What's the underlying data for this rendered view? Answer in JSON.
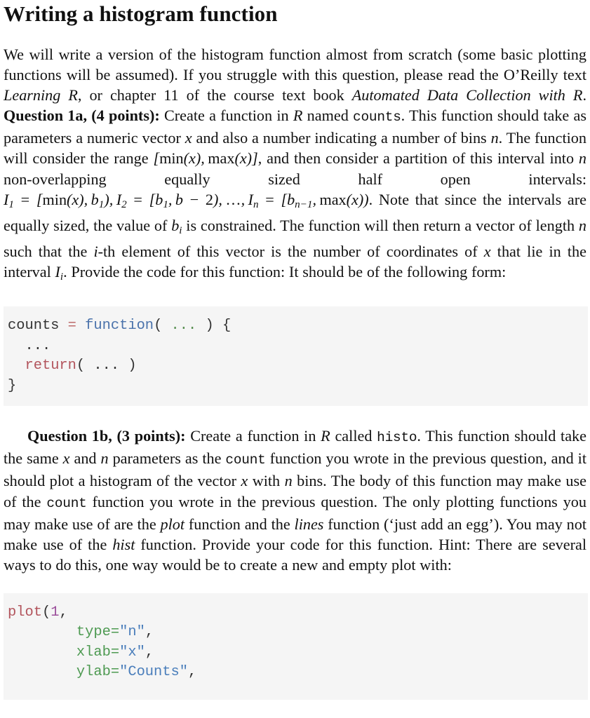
{
  "document": {
    "title": "Writing a histogram function",
    "paragraph_1": {
      "segments": [
        {
          "text": "We will write a version of the histogram function almost from scratch (some basic plotting functions will be assumed). If you struggle with this question, please read the O’Reilly text ",
          "style": "normal"
        },
        {
          "text": "Learning R",
          "style": "italic"
        },
        {
          "text": ", or chapter 11 of the course text book ",
          "style": "normal"
        },
        {
          "text": "Automated Data Collection with R",
          "style": "italic"
        },
        {
          "text": ". ",
          "style": "normal"
        },
        {
          "text": "Question 1a, (4 points):",
          "style": "bold"
        },
        {
          "text": " Create a function in ",
          "style": "normal"
        },
        {
          "text": "R",
          "style": "math-italic"
        },
        {
          "text": " named ",
          "style": "normal"
        },
        {
          "text": "counts",
          "style": "mono"
        },
        {
          "text": ". This function should take as parameters a numeric vector ",
          "style": "normal"
        },
        {
          "text": "x",
          "style": "math-italic"
        },
        {
          "text": " and also a number indicating a number of bins ",
          "style": "normal"
        },
        {
          "text": "n",
          "style": "math-italic"
        },
        {
          "text": ". The function will consider the range ",
          "style": "normal"
        },
        {
          "text": "[min(x), max(x)]",
          "style": "math"
        },
        {
          "text": ", and then consider a partition of this interval into ",
          "style": "normal"
        },
        {
          "text": "n",
          "style": "math-italic"
        },
        {
          "text": " non-overlapping equally sized half open intervals: ",
          "style": "normal"
        },
        {
          "text": "I1 = [min(x), b1), I2 = [b1, b − 2), … , In = [bn−1, max(x))",
          "style": "math"
        },
        {
          "text": ". Note that since the intervals are equally sized, the value of ",
          "style": "normal"
        },
        {
          "text": "bi",
          "style": "math"
        },
        {
          "text": " is constrained. The function will then return a vector of length ",
          "style": "normal"
        },
        {
          "text": "n",
          "style": "math-italic"
        },
        {
          "text": " such that the ",
          "style": "normal"
        },
        {
          "text": "i",
          "style": "math-italic"
        },
        {
          "text": "-th element of this vector is the number of coordinates of ",
          "style": "normal"
        },
        {
          "text": "x",
          "style": "math-italic"
        },
        {
          "text": " that lie in the interval ",
          "style": "normal"
        },
        {
          "text": "Ii",
          "style": "math"
        },
        {
          "text": ". Provide the code for this function: It should be of the following form:",
          "style": "normal"
        }
      ],
      "plain_text": "We will write a version of the histogram function almost from scratch (some basic plotting functions will be assumed). If you struggle with this question, please read the O’Reilly text Learning R, or chapter 11 of the course text book Automated Data Collection with R. Question 1a, (4 points): Create a function in R named counts. This function should take as parameters a numeric vector x and also a number indicating a number of bins n. The function will consider the range [min(x), max(x)], and then consider a partition of this interval into n non-overlapping equally sized half open intervals: I_1 = [min(x), b_1), I_2 = [b_1, b − 2), …, I_n = [b_{n−1}, max(x)). Note that since the intervals are equally sized, the value of b_i is constrained. The function will then return a vector of length n such that the i-th element of this vector is the number of coordinates of x that lie in the interval I_i. Provide the code for this function: It should be of the following form:"
    },
    "code_block_1": {
      "language": "R",
      "lines": [
        [
          {
            "t": "counts ",
            "c": "plain"
          },
          {
            "t": "=",
            "c": "op"
          },
          {
            "t": " ",
            "c": "plain"
          },
          {
            "t": "function",
            "c": "fn"
          },
          {
            "t": "( ",
            "c": "plain"
          },
          {
            "t": "...",
            "c": "dots"
          },
          {
            "t": " ) {",
            "c": "plain"
          }
        ],
        [
          {
            "t": "  ",
            "c": "plain"
          },
          {
            "t": "...",
            "c": "plain"
          }
        ],
        [
          {
            "t": "  ",
            "c": "plain"
          },
          {
            "t": "return",
            "c": "return"
          },
          {
            "t": "( ... )",
            "c": "plain"
          }
        ],
        [
          {
            "t": "}",
            "c": "plain"
          }
        ]
      ],
      "plain_text": "counts = function( ... ) {\n  ...\n  return( ... )\n}"
    },
    "paragraph_2": {
      "segments": [
        {
          "text": "Question 1b, (3 points):",
          "style": "bold"
        },
        {
          "text": " Create a function in ",
          "style": "normal"
        },
        {
          "text": "R",
          "style": "math-italic"
        },
        {
          "text": " called ",
          "style": "normal"
        },
        {
          "text": "histo",
          "style": "mono"
        },
        {
          "text": ". This function should take the same ",
          "style": "normal"
        },
        {
          "text": "x",
          "style": "math-italic"
        },
        {
          "text": " and ",
          "style": "normal"
        },
        {
          "text": "n",
          "style": "math-italic"
        },
        {
          "text": " parameters as the ",
          "style": "normal"
        },
        {
          "text": "count",
          "style": "mono"
        },
        {
          "text": " function you wrote in the previous question, and it should plot a histogram of the vector ",
          "style": "normal"
        },
        {
          "text": "x",
          "style": "math-italic"
        },
        {
          "text": " with ",
          "style": "normal"
        },
        {
          "text": "n",
          "style": "math-italic"
        },
        {
          "text": " bins. The body of this function may make use of the ",
          "style": "normal"
        },
        {
          "text": "count",
          "style": "mono"
        },
        {
          "text": " function you wrote in the previous question. The only plotting functions you may make use of are the ",
          "style": "normal"
        },
        {
          "text": "plot",
          "style": "italic"
        },
        {
          "text": " function and the ",
          "style": "normal"
        },
        {
          "text": "lines",
          "style": "italic"
        },
        {
          "text": " function (‘just add an egg’). You may not make use of the ",
          "style": "normal"
        },
        {
          "text": "hist",
          "style": "italic"
        },
        {
          "text": " function. Provide your code for this function. Hint: There are several ways to do this, one way would be to create a new and empty plot with:",
          "style": "normal"
        }
      ],
      "plain_text": "Question 1b, (3 points): Create a function in R called histo. This function should take the same x and n parameters as the count function you wrote in the previous question, and it should plot a histogram of the vector x with n bins. The body of this function may make use of the count function you wrote in the previous question. The only plotting functions you may make use of are the plot function and the lines function (‘just add an egg’). You may not make use of the hist function. Provide your code for this function. Hint: There are several ways to do this, one way would be to create a new and empty plot with:"
    },
    "code_block_2": {
      "language": "R",
      "truncated": true,
      "lines": [
        [
          {
            "t": "plot",
            "c": "call"
          },
          {
            "t": "(",
            "c": "punct"
          },
          {
            "t": "1",
            "c": "num"
          },
          {
            "t": ",",
            "c": "punct"
          }
        ],
        [
          {
            "t": "        ",
            "c": "punct"
          },
          {
            "t": "type=",
            "c": "arg"
          },
          {
            "t": "\"n\"",
            "c": "str"
          },
          {
            "t": ",",
            "c": "punct"
          }
        ],
        [
          {
            "t": "        ",
            "c": "punct"
          },
          {
            "t": "xlab=",
            "c": "arg"
          },
          {
            "t": "\"x\"",
            "c": "str"
          },
          {
            "t": ",",
            "c": "punct"
          }
        ],
        [
          {
            "t": "        ",
            "c": "punct"
          },
          {
            "t": "ylab=",
            "c": "arg"
          },
          {
            "t": "\"Counts\"",
            "c": "str"
          },
          {
            "t": ",",
            "c": "punct"
          }
        ]
      ],
      "plain_text": "plot(1,\n        type=\"n\",\n        xlab=\"x\",\n        ylab=\"Counts\","
    },
    "colors": {
      "page_background": "#ffffff",
      "text": "#111111",
      "code_background": "#f5f5f5",
      "code_text": "#333333",
      "token_function": "#4a72ab",
      "token_operator": "#bd6b6b",
      "token_ellipsis": "#5a9153",
      "token_return": "#b2545c",
      "token_call": "#b2545c",
      "token_number": "#9b4f9b",
      "token_argument": "#4e9a52",
      "token_string": "#4a7ebb"
    }
  }
}
